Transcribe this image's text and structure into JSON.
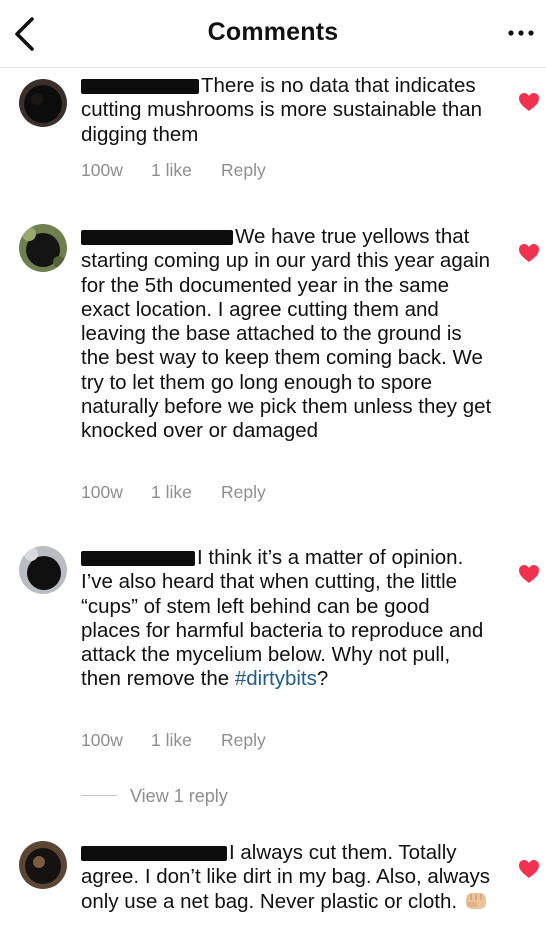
{
  "header": {
    "title": "Comments",
    "back_icon": "chevron-left-icon",
    "more_icon": "more-horizontal-icon"
  },
  "comments": [
    {
      "text": "There is no data that indicates cutting mushrooms is more sustainable than digging them",
      "time": "100w",
      "likes": "1 like",
      "reply": "Reply"
    },
    {
      "text": "We have true yellows that starting coming up in our yard this year again for the 5th documented year in the same exact location.  I agree cutting them and leaving the base attached to the ground is the best way to keep them coming back.  We try to let them go long enough to spore naturally before we pick them unless they get knocked over or damaged",
      "time": "100w",
      "likes": "1 like",
      "reply": "Reply"
    },
    {
      "text_before_tag": "I think it’s a matter of opinion. I’ve also heard that when cutting, the little “cups” of stem left behind can be good places for harmful bacteria to reproduce and attack the mycelium below.  Why not pull, then remove the ",
      "hashtag": "#dirtybits",
      "text_after_tag": "?",
      "time": "100w",
      "likes": "1 like",
      "reply": "Reply",
      "view_replies": "View 1 reply"
    },
    {
      "text": "I always cut them. Totally agree. I don’t like dirt in my bag. Also, always only use a net bag. Never plastic or cloth.",
      "emoji": "fist-icon"
    }
  ],
  "colors": {
    "heart": "#f0314f",
    "meta": "#8e8e8e",
    "hashtag": "#1f5b8c"
  }
}
